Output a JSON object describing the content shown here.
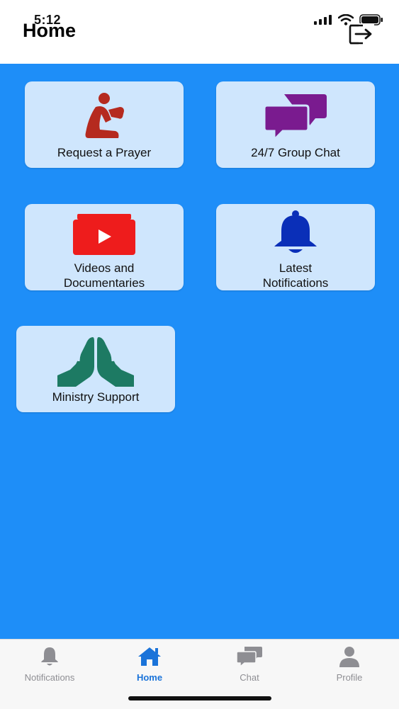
{
  "status_bar": {
    "time": "5:12"
  },
  "header": {
    "title": "Home"
  },
  "tiles": [
    {
      "label": "Request a Prayer",
      "icon": "kneeling-prayer-icon",
      "color": "#b52a1f"
    },
    {
      "label": "24/7 Group Chat",
      "icon": "chat-bubbles-icon",
      "color": "#7a1b8f"
    },
    {
      "label_line1": "Videos and",
      "label_line2": "Documentaries",
      "icon": "video-folder-icon",
      "color": "#ee1c1c"
    },
    {
      "label_line1": "Latest",
      "label_line2": "Notifications",
      "icon": "bell-icon",
      "color": "#0a2fb8"
    },
    {
      "label": "Ministry Support",
      "icon": "praying-hands-icon",
      "color": "#1d7a63"
    }
  ],
  "tabbar": {
    "items": [
      {
        "label": "Notifications",
        "icon": "bell-icon"
      },
      {
        "label": "Home",
        "icon": "house-icon",
        "active": true
      },
      {
        "label": "Chat",
        "icon": "chat-icon"
      },
      {
        "label": "Profile",
        "icon": "person-icon"
      }
    ]
  },
  "colors": {
    "background": "#1e8ef8",
    "tile": "#cfe6fd",
    "tab_active": "#1a73d9",
    "tab_inactive": "#8e8e93"
  }
}
